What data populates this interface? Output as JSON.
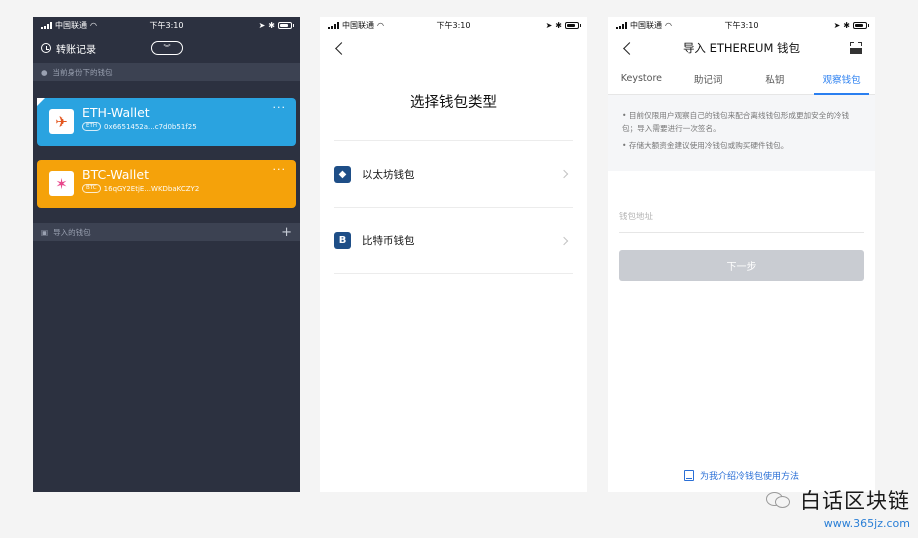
{
  "status_bar": {
    "carrier": "中国联通",
    "time": "下午3:10",
    "bluetooth": "✱",
    "location": "➤"
  },
  "screen1": {
    "header_title": "转账记录",
    "toggle_icon": "chevron-double-down-icon",
    "identity_section_label": "当前身份下的钱包",
    "wallets": [
      {
        "name": "ETH-Wallet",
        "tag": "ETH",
        "address": "0x6651452a...c7d0b51f25",
        "color": "#2aa3e0",
        "logo": "eth-wallet-logo-icon"
      },
      {
        "name": "BTC-Wallet",
        "tag": "BTC",
        "address": "16qGY2EtjE...WKDbaKCZY2",
        "color": "#f5a20a",
        "logo": "btc-wallet-logo-icon"
      }
    ],
    "more_glyph": "···",
    "imported_section_label": "导入的钱包",
    "add_glyph": "+"
  },
  "screen2": {
    "title": "选择钱包类型",
    "options": [
      {
        "label": "以太坊钱包",
        "icon_glyph": "◆"
      },
      {
        "label": "比特币钱包",
        "icon_glyph": "B"
      }
    ]
  },
  "screen3": {
    "title": "导入 ETHEREUM 钱包",
    "tabs": [
      "Keystore",
      "助记词",
      "私钥",
      "观察钱包"
    ],
    "active_tab": 3,
    "notices": [
      "• 目前仅限用户观察自己的钱包来配合离线钱包形成更加安全的冷钱包；导入需要进行一次签名。",
      "• 存储大额资金建议使用冷钱包或购买硬件钱包。"
    ],
    "address_placeholder": "钱包地址",
    "next_button": "下一步",
    "footer_link": "为我介绍冷钱包使用方法"
  },
  "watermark": {
    "name": "白话区块链",
    "url": "www.365jz.com"
  },
  "colors": {
    "dark_bg": "#2c3140",
    "accent_blue": "#2a7ff0",
    "eth_card": "#2aa3e0",
    "btc_card": "#f5a20a"
  }
}
